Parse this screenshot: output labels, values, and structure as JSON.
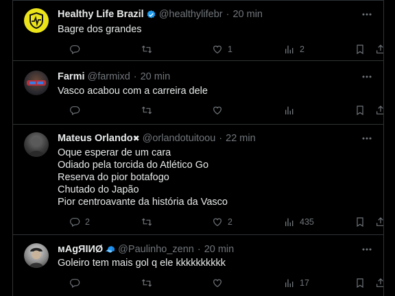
{
  "tweets": [
    {
      "name": "Healthy Life Brazil",
      "verified": true,
      "handle": "@healthylifebr",
      "time": "20 min",
      "lines": [
        "Bagre dos grandes"
      ],
      "reply_count": "",
      "retweet_count": "",
      "like_count": "1",
      "view_count": "2"
    },
    {
      "name": "Farmi",
      "verified": false,
      "handle": "@farmixd",
      "time": "20 min",
      "lines": [
        "Vasco acabou com a carreira dele"
      ],
      "reply_count": "",
      "retweet_count": "",
      "like_count": "",
      "view_count": ""
    },
    {
      "name": "Mateus Orlando",
      "name_emoji": "✖",
      "verified": false,
      "handle": "@orlandotuitoou",
      "time": "22 min",
      "lines": [
        "Oque esperar de um cara",
        "Odiado pela torcida do Atlético Go",
        "Reserva do pior botafogo",
        "Chutado do Japão",
        "Pior centroavante da história da Vasco"
      ],
      "reply_count": "2",
      "retweet_count": "",
      "like_count": "2",
      "view_count": "435"
    },
    {
      "name": "мАgЯІИØ",
      "name_emoji": "🧢",
      "verified": false,
      "handle": "@Paulinho_zenn",
      "time": "20 min",
      "lines": [
        "Goleiro tem mais gol q ele kkkkkkkkkk"
      ],
      "reply_count": "",
      "retweet_count": "",
      "like_count": "",
      "view_count": "17"
    }
  ],
  "separator": "·",
  "icons": [
    "reply-icon",
    "retweet-icon",
    "like-icon",
    "views-icon",
    "bookmark-icon",
    "share-icon",
    "more-icon",
    "verified-badge-icon"
  ],
  "colors": {
    "background": "#000000",
    "text": "#e7e9ea",
    "muted": "#71767b",
    "border": "#2f3336",
    "verified": "#1d9bf0",
    "brand_avatar": "#f0e61e"
  }
}
